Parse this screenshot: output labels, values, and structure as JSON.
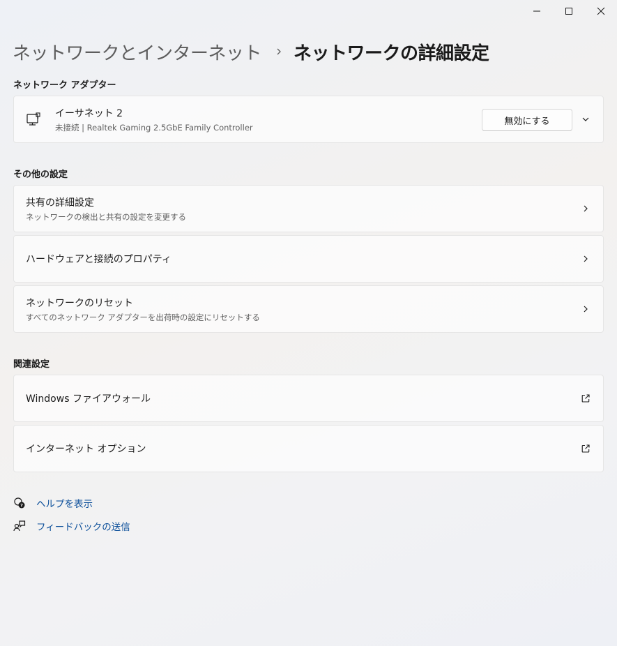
{
  "window_controls": {
    "minimize_icon": "minimize-icon",
    "maximize_icon": "maximize-icon",
    "close_icon": "close-icon"
  },
  "breadcrumb": {
    "parent": "ネットワークとインターネット",
    "separator_icon": "chevron-right-icon",
    "current": "ネットワークの詳細設定"
  },
  "adapters_section": {
    "title": "ネットワーク アダプター",
    "adapter": {
      "icon": "ethernet-icon",
      "name": "イーサネット 2",
      "status": "未接続 | Realtek Gaming 2.5GbE Family Controller",
      "disable_label": "無効にする",
      "expand_icon": "chevron-down-icon"
    }
  },
  "more_section": {
    "title": "その他の設定",
    "items": [
      {
        "title": "共有の詳細設定",
        "subtitle": "ネットワークの検出と共有の設定を変更する"
      },
      {
        "title": "ハードウェアと接続のプロパティ",
        "subtitle": ""
      },
      {
        "title": "ネットワークのリセット",
        "subtitle": "すべてのネットワーク アダプターを出荷時の設定にリセットする"
      }
    ]
  },
  "related_section": {
    "title": "関連設定",
    "items": [
      {
        "title": "Windows ファイアウォール",
        "icon": "external-link-icon"
      },
      {
        "title": "インターネット オプション",
        "icon": "external-link-icon"
      }
    ]
  },
  "footer_links": {
    "help": {
      "label": "ヘルプを表示",
      "icon": "help-icon"
    },
    "feedback": {
      "label": "フィードバックの送信",
      "icon": "feedback-icon"
    }
  },
  "colors": {
    "link": "#0b4f9a",
    "card_bg": "#fbfbfb",
    "border": "#e5e5e5"
  }
}
